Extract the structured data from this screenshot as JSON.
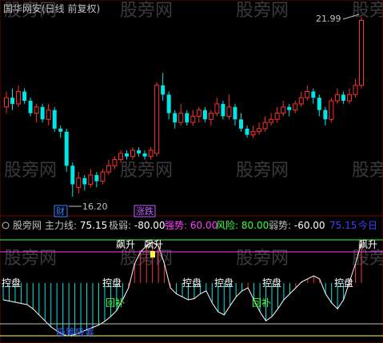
{
  "watermark": "股旁网",
  "top_panel": {
    "title": "国华网安(日线 前复权)",
    "max_label": "21.99",
    "min_label": "16.20",
    "tags": [
      {
        "text": "财",
        "color": "#3f80ff"
      },
      {
        "text": "涨跌",
        "color": "#c060ff"
      }
    ]
  },
  "bottom_panel": {
    "header": {
      "name": "股旁网",
      "items": [
        {
          "label": "主力线:",
          "value": "75.15",
          "color": "#ffffff"
        },
        {
          "label": "极弱:",
          "value": "-80.00",
          "color": "#ffffff"
        },
        {
          "label": "强势:",
          "value": "60.00",
          "color": "#ff40ff"
        },
        {
          "label": "风险:",
          "value": "80.00",
          "color": "#40ff40"
        },
        {
          "label": "弱势:",
          "value": "-60.00",
          "color": "#ffffff"
        },
        {
          "label": "",
          "value": "75.15",
          "color": "#4040ff"
        },
        {
          "label": "",
          "value": "今日",
          "color": "#4040ff"
        }
      ]
    },
    "annotations": {
      "kongpan": "控盘",
      "biaosheng": "飙升",
      "huibu": "回补",
      "xixi": "吸筹吸筹"
    }
  },
  "chart_data": {
    "type": "candlestick+oscillator",
    "candles": [
      {
        "o": 19.1,
        "c": 19.4,
        "h": 19.6,
        "l": 18.9
      },
      {
        "o": 19.4,
        "c": 19.2,
        "h": 19.7,
        "l": 19.0
      },
      {
        "o": 19.2,
        "c": 19.6,
        "h": 19.8,
        "l": 19.1
      },
      {
        "o": 19.6,
        "c": 19.3,
        "h": 19.7,
        "l": 19.2
      },
      {
        "o": 19.3,
        "c": 18.9,
        "h": 19.4,
        "l": 18.8
      },
      {
        "o": 18.9,
        "c": 19.1,
        "h": 19.2,
        "l": 18.6
      },
      {
        "o": 19.1,
        "c": 18.7,
        "h": 19.2,
        "l": 18.6
      },
      {
        "o": 18.7,
        "c": 19.0,
        "h": 19.2,
        "l": 18.5
      },
      {
        "o": 19.0,
        "c": 18.4,
        "h": 19.1,
        "l": 18.3
      },
      {
        "o": 18.4,
        "c": 18.3,
        "h": 18.5,
        "l": 18.1
      },
      {
        "o": 18.3,
        "c": 17.2,
        "h": 18.4,
        "l": 17.0
      },
      {
        "o": 17.2,
        "c": 16.6,
        "h": 17.3,
        "l": 16.2
      },
      {
        "o": 16.5,
        "c": 16.8,
        "h": 17.0,
        "l": 16.3
      },
      {
        "o": 16.8,
        "c": 16.6,
        "h": 16.9,
        "l": 16.4
      },
      {
        "o": 16.6,
        "c": 16.9,
        "h": 17.1,
        "l": 16.5
      },
      {
        "o": 16.9,
        "c": 16.7,
        "h": 17.0,
        "l": 16.5
      },
      {
        "o": 16.7,
        "c": 17.0,
        "h": 17.1,
        "l": 16.6
      },
      {
        "o": 17.0,
        "c": 17.2,
        "h": 17.4,
        "l": 16.9
      },
      {
        "o": 17.2,
        "c": 17.4,
        "h": 17.5,
        "l": 17.1
      },
      {
        "o": 17.4,
        "c": 17.6,
        "h": 17.7,
        "l": 17.3
      },
      {
        "o": 17.6,
        "c": 17.5,
        "h": 17.7,
        "l": 17.4
      },
      {
        "o": 17.5,
        "c": 17.7,
        "h": 17.8,
        "l": 17.4
      },
      {
        "o": 17.7,
        "c": 17.6,
        "h": 17.8,
        "l": 17.5
      },
      {
        "o": 17.6,
        "c": 17.5,
        "h": 17.7,
        "l": 17.4
      },
      {
        "o": 17.5,
        "c": 17.7,
        "h": 17.8,
        "l": 17.4
      },
      {
        "o": 17.6,
        "c": 19.8,
        "h": 19.9,
        "l": 17.5
      },
      {
        "o": 19.8,
        "c": 19.5,
        "h": 20.2,
        "l": 19.3
      },
      {
        "o": 19.5,
        "c": 18.9,
        "h": 19.6,
        "l": 18.7
      },
      {
        "o": 18.9,
        "c": 18.6,
        "h": 19.0,
        "l": 18.4
      },
      {
        "o": 18.6,
        "c": 18.9,
        "h": 19.2,
        "l": 18.5
      },
      {
        "o": 18.9,
        "c": 18.6,
        "h": 19.0,
        "l": 18.5
      },
      {
        "o": 18.6,
        "c": 18.8,
        "h": 19.0,
        "l": 18.5
      },
      {
        "o": 18.8,
        "c": 19.0,
        "h": 19.1,
        "l": 18.6
      },
      {
        "o": 19.0,
        "c": 18.7,
        "h": 19.1,
        "l": 18.6
      },
      {
        "o": 18.7,
        "c": 18.9,
        "h": 19.0,
        "l": 18.5
      },
      {
        "o": 18.9,
        "c": 19.2,
        "h": 19.4,
        "l": 18.8
      },
      {
        "o": 19.2,
        "c": 18.8,
        "h": 19.3,
        "l": 18.7
      },
      {
        "o": 18.8,
        "c": 19.1,
        "h": 19.5,
        "l": 18.7
      },
      {
        "o": 19.1,
        "c": 18.7,
        "h": 19.2,
        "l": 18.5
      },
      {
        "o": 18.7,
        "c": 18.4,
        "h": 18.9,
        "l": 18.3
      },
      {
        "o": 18.4,
        "c": 18.2,
        "h": 18.5,
        "l": 18.1
      },
      {
        "o": 18.2,
        "c": 18.3,
        "h": 18.5,
        "l": 18.1
      },
      {
        "o": 18.3,
        "c": 18.4,
        "h": 18.6,
        "l": 18.2
      },
      {
        "o": 18.4,
        "c": 18.6,
        "h": 18.8,
        "l": 18.3
      },
      {
        "o": 18.6,
        "c": 18.7,
        "h": 18.9,
        "l": 18.5
      },
      {
        "o": 18.7,
        "c": 18.9,
        "h": 19.1,
        "l": 18.6
      },
      {
        "o": 18.9,
        "c": 19.1,
        "h": 19.3,
        "l": 18.8
      },
      {
        "o": 19.1,
        "c": 19.0,
        "h": 19.2,
        "l": 18.8
      },
      {
        "o": 19.0,
        "c": 19.2,
        "h": 19.3,
        "l": 18.9
      },
      {
        "o": 19.2,
        "c": 19.4,
        "h": 19.6,
        "l": 19.1
      },
      {
        "o": 19.4,
        "c": 19.6,
        "h": 19.8,
        "l": 19.3
      },
      {
        "o": 19.6,
        "c": 19.4,
        "h": 19.7,
        "l": 19.2
      },
      {
        "o": 19.4,
        "c": 19.0,
        "h": 19.5,
        "l": 18.8
      },
      {
        "o": 19.0,
        "c": 18.7,
        "h": 19.1,
        "l": 18.5
      },
      {
        "o": 18.7,
        "c": 19.3,
        "h": 19.4,
        "l": 18.6
      },
      {
        "o": 19.3,
        "c": 19.5,
        "h": 19.7,
        "l": 19.2
      },
      {
        "o": 19.5,
        "c": 19.3,
        "h": 19.6,
        "l": 19.2
      },
      {
        "o": 19.3,
        "c": 19.5,
        "h": 19.7,
        "l": 19.2
      },
      {
        "o": 19.5,
        "c": 19.8,
        "h": 20.0,
        "l": 19.4
      },
      {
        "o": 19.8,
        "c": 21.9,
        "h": 21.99,
        "l": 19.7
      }
    ],
    "oscillator": [
      -20,
      -22,
      -24,
      -26,
      -28,
      -35,
      -45,
      -55,
      -65,
      -72,
      -78,
      -80,
      -78,
      -74,
      -70,
      -66,
      -62,
      -56,
      -48,
      -38,
      -20,
      0,
      40,
      60,
      70,
      76,
      70,
      40,
      0,
      -10,
      -15,
      -20,
      -18,
      -10,
      -5,
      -25,
      -40,
      -45,
      -30,
      -15,
      -5,
      0,
      -20,
      -40,
      -55,
      -48,
      -35,
      -20,
      -10,
      0,
      10,
      15,
      20,
      15,
      -10,
      -25,
      -35,
      -20,
      10,
      40,
      75.15
    ],
    "levels": {
      "extreme_weak": -80,
      "strong": 60,
      "risk": 80,
      "weak": -60
    }
  }
}
